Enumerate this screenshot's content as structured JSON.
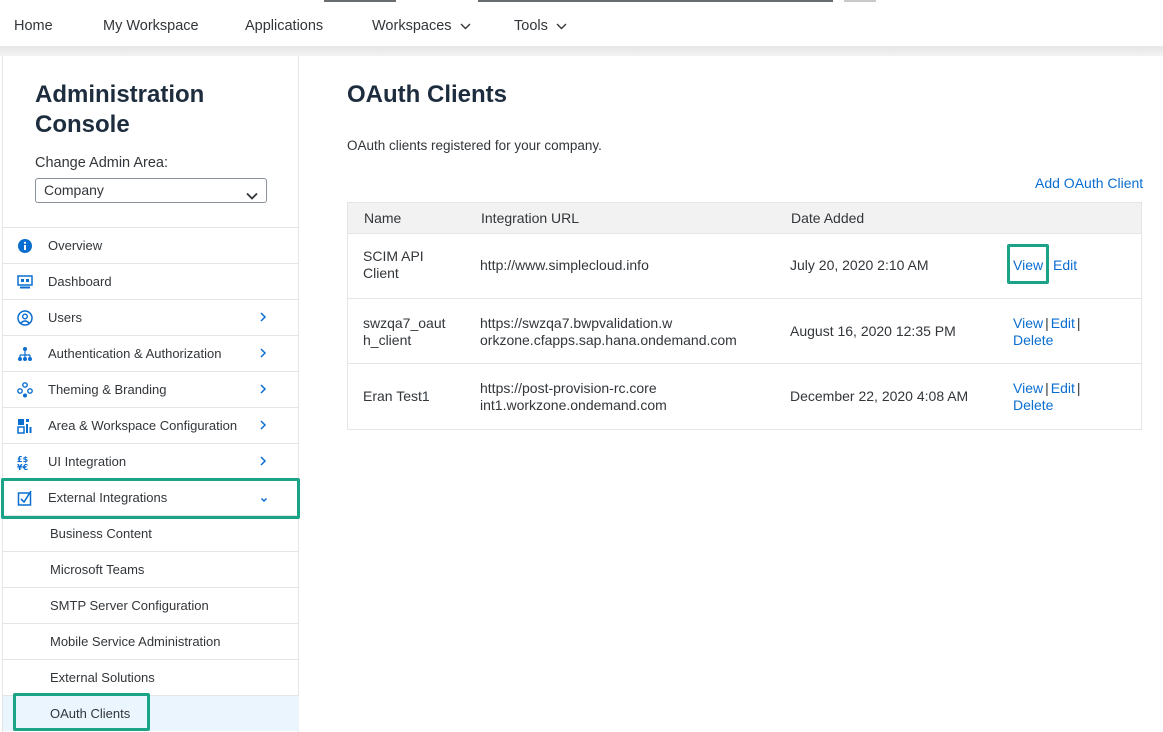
{
  "topnav": {
    "items": [
      {
        "label": "Home"
      },
      {
        "label": "My Workspace"
      },
      {
        "label": "Applications"
      },
      {
        "label": "Workspaces",
        "has_dropdown": true
      },
      {
        "label": "Tools",
        "has_dropdown": true
      }
    ]
  },
  "sidebar": {
    "title_line1": "Administration",
    "title_line2": "Console",
    "change_label": "Change Admin Area:",
    "admin_area": "Company",
    "items": [
      {
        "label": "Overview",
        "icon": "info-icon"
      },
      {
        "label": "Dashboard",
        "icon": "dashboard-icon"
      },
      {
        "label": "Users",
        "icon": "user-icon"
      },
      {
        "label": "Authentication & Authorization",
        "icon": "org-chart-icon"
      },
      {
        "label": "Theming & Branding",
        "icon": "palette-icon"
      },
      {
        "label": "Area & Workspace Configuration",
        "icon": "configuration-icon"
      },
      {
        "label": "UI Integration",
        "icon": "ui-integration-icon"
      },
      {
        "label": "External Integrations",
        "icon": "external-integration-icon",
        "expanded": true
      }
    ],
    "sub_items": [
      {
        "label": "Business Content"
      },
      {
        "label": "Microsoft Teams"
      },
      {
        "label": "SMTP Server Configuration"
      },
      {
        "label": "Mobile Service Administration"
      },
      {
        "label": "External Solutions"
      },
      {
        "label": "OAuth Clients",
        "selected": true
      }
    ]
  },
  "main": {
    "title": "OAuth Clients",
    "description": "OAuth clients registered for your company.",
    "add_link": "Add OAuth Client",
    "columns": [
      "Name",
      "Integration URL",
      "Date Added"
    ],
    "rows": [
      {
        "name_l1": "SCIM API",
        "name_l2": "Client",
        "url_l1": "http://www.simplecloud.info",
        "url_l2": "",
        "date": "July 20, 2020 2:10 AM",
        "view": "View",
        "edit": "Edit",
        "delete": ""
      },
      {
        "name_l1": "swzqa7_oaut",
        "name_l2": "h_client",
        "url_l1": "https://swzqa7.bwpvalidation.w",
        "url_l2": "orkzone.cfapps.sap.hana.ondemand.com",
        "date": "August 16, 2020 12:35 PM",
        "view": "View",
        "edit": "Edit",
        "delete": "Delete"
      },
      {
        "name_l1": "Eran Test1",
        "name_l2": "",
        "url_l1": "https://post-provision-rc.core",
        "url_l2": "int1.workzone.ondemand.com",
        "date": "December 22, 2020 4:08 AM",
        "view": "View",
        "edit": "Edit",
        "delete": "Delete"
      }
    ],
    "separator": "|"
  },
  "colors": {
    "link": "#0a6ed1",
    "highlight": "#1aa386",
    "selected_bg": "#ebf5fe",
    "icon": "#0a6ed1"
  }
}
